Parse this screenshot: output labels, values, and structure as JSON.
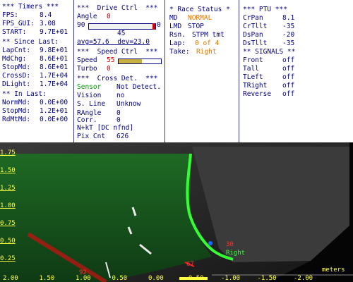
{
  "timers": {
    "header": "*** Timers ***",
    "fps_label": "FPS:",
    "fps": "8.4",
    "fpsgui_label": "FPS_GUI:",
    "fpsgui": "3.08",
    "start_label": "START:",
    "start": "9.7E+01",
    "since_header": "** Since Last:",
    "lapcnt_label": "LapCnt:",
    "lapcnt": "9.8E+01",
    "mdchg_label": "MdChg:",
    "mdchg": "8.6E+01",
    "stopmd_label": "StopMd:",
    "stopmd": "8.6E+01",
    "crossd_label": "CrossD:",
    "crossd": "1.7E+04",
    "dlight_label": "DLight:",
    "dlight": "1.7E+04",
    "inlast_header": "** In Last:",
    "normmd_label": "NormMd:",
    "normmd": "0.0E+00",
    "stopmd2_label": "StopMd:",
    "stopmd2": "1.2E+01",
    "rdmtmd_label": "RdMtMd:",
    "rdmtmd": "0.0E+00"
  },
  "drive": {
    "header": "***  Drive Ctrl  ***",
    "angle_label": "Angle",
    "angle": "0",
    "slider_min": "90",
    "slider_max": "0",
    "slider_mid": "45",
    "avg_text": "avg=57.6  dev=23.0",
    "speed_header": "***  Speed Ctrl  ***",
    "speed_label": "Speed",
    "speed": "55",
    "turbo_label": "Turbo",
    "turbo": "0",
    "cross_header": "***  Cross Det.  ***",
    "sensor_label": "Sensor",
    "sensor": "Not Detect.",
    "vision_label": "Vision",
    "vision": "no",
    "sline_label": "S. Line",
    "sline": "Unknow",
    "rangle_label": "RAngle",
    "rangle": "0",
    "corr_label": "Corr.",
    "corr": "0",
    "nkt_text": "N+kT [DC nfnd]",
    "pix_label": "Pix Cnt",
    "pix": "626"
  },
  "race": {
    "header": "* Race Status *",
    "md_label": "MD",
    "md": "NORMAL",
    "lmd_label": "LMD",
    "lmd": "STOP",
    "rsn_label": "Rsn.",
    "rsn": "STPM tmt",
    "lap_label": "Lap:",
    "lap": "0 of 4",
    "take_label": "Take:",
    "take": "Right"
  },
  "ptu": {
    "header": "*** PTU ***",
    "crpan_label": "CrPan",
    "crpan": "8.1",
    "crtilt_label": "CrTllt",
    "crtilt": "-35",
    "dspan_label": "DsPan",
    "dspan": "-20",
    "dstilt_label": "DsTllt",
    "dstilt": "-35",
    "signals_header": "** SIGNALS **",
    "front_label": "Front",
    "front": "off",
    "tail_label": "Tall",
    "tail": "off",
    "tleft_label": "TLeft",
    "tleft": "off",
    "tright_label": "TRight",
    "tright": "off",
    "reverse_label": "Reverse",
    "reverse": "off"
  },
  "scene": {
    "y_ticks": [
      "1.75",
      "1.50",
      "1.25",
      "1.00",
      "0.75",
      "0.50",
      "0.25"
    ],
    "x_ticks": [
      "2.00",
      "1.50",
      "1.00",
      "0.50",
      "0.00",
      "-0.50",
      "-1.00",
      "-1.50",
      "-2.00"
    ],
    "units": "meters",
    "right_label": "Right",
    "n30": "30",
    "n67": "67",
    "n92": "92"
  },
  "colors": {
    "panel_text": "#000080",
    "warn": "#d00000",
    "status_orange": "#e07a00",
    "ok_green": "#00a000",
    "overlay_green": "#33ff33",
    "axis_yellow": "#ffff40"
  }
}
